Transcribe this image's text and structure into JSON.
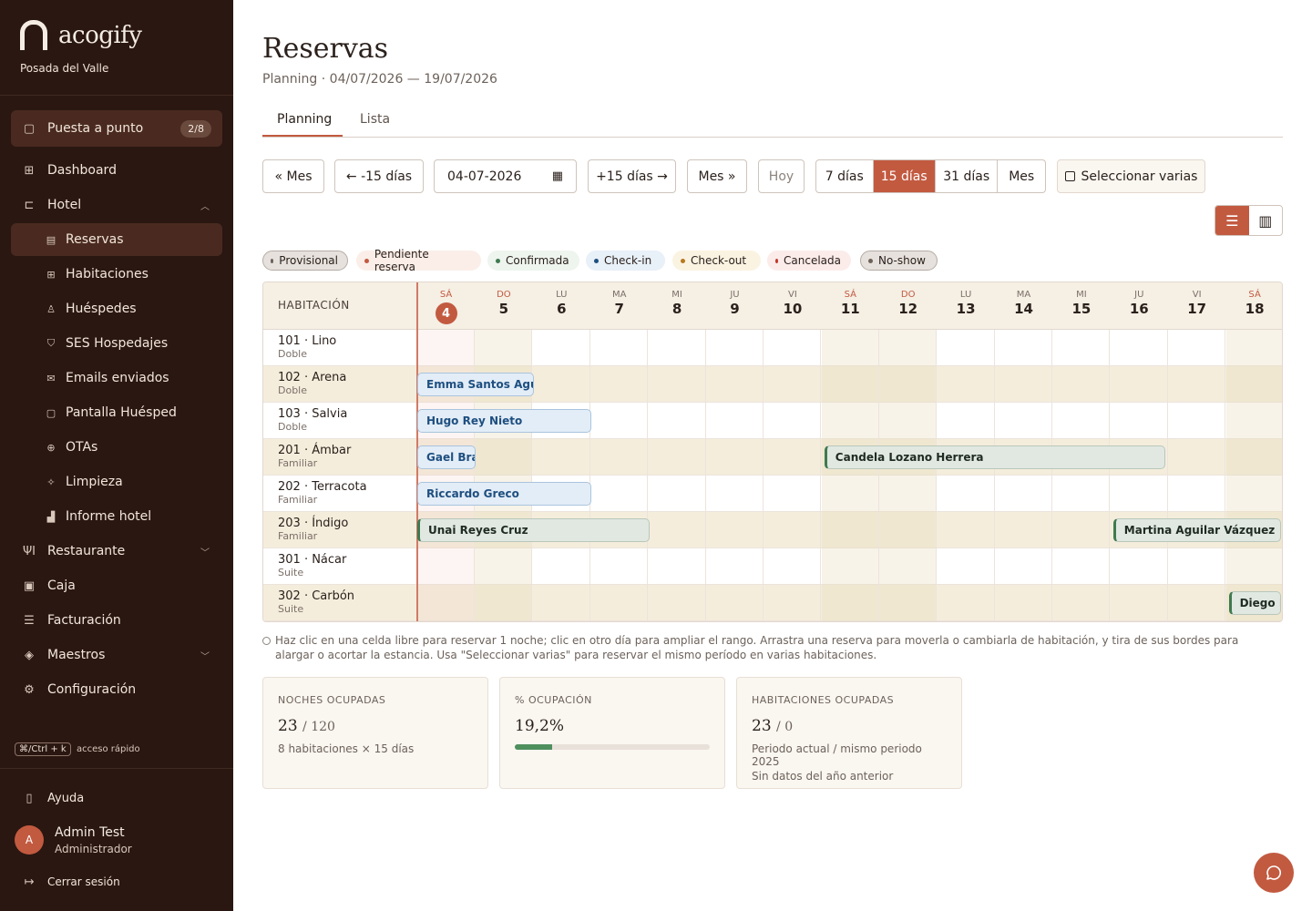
{
  "sidebar": {
    "brand": "acogify",
    "hotel": "Posada del Valle",
    "items": [
      {
        "label": "Puesta a punto",
        "badge": "2/8"
      },
      {
        "label": "Dashboard"
      },
      {
        "label": "Hotel"
      },
      {
        "label": "Reservas"
      },
      {
        "label": "Habitaciones"
      },
      {
        "label": "Huéspedes"
      },
      {
        "label": "SES Hospedajes"
      },
      {
        "label": "Emails enviados"
      },
      {
        "label": "Pantalla Huésped"
      },
      {
        "label": "OTAs"
      },
      {
        "label": "Limpieza"
      },
      {
        "label": "Informe hotel"
      },
      {
        "label": "Restaurante"
      },
      {
        "label": "Caja"
      },
      {
        "label": "Facturación"
      },
      {
        "label": "Maestros"
      },
      {
        "label": "Configuración"
      }
    ],
    "shortcut_key": "⌘/Ctrl + k",
    "shortcut_label": "acceso rápido",
    "help": "Ayuda",
    "user_initial": "A",
    "user_name": "Admin Test",
    "user_role": "Administrador",
    "logout": "Cerrar sesión"
  },
  "page": {
    "title": "Reservas",
    "subtitle": "Planning · 04/07/2026 — 19/07/2026"
  },
  "tabs": [
    "Planning",
    "Lista"
  ],
  "toolbar": {
    "prev_month": "« Mes",
    "prev_15": "← -15 días",
    "date": "04-07-2026",
    "next_15": "+15 días →",
    "next_month": "Mes »",
    "today": "Hoy",
    "ranges": [
      "7 días",
      "15 días",
      "31 días",
      "Mes"
    ],
    "multi": "Seleccionar varias"
  },
  "legend": [
    {
      "label": "Provisional",
      "color": "#6d625b",
      "bg": "#e6e1dc"
    },
    {
      "label": "Pendiente reserva",
      "color": "#c25a40",
      "bg": "#fbeee8"
    },
    {
      "label": "Confirmada",
      "color": "#3f7a4f",
      "bg": "#eef4ee"
    },
    {
      "label": "Check-in",
      "color": "#1e4f80",
      "bg": "#e8f0f8"
    },
    {
      "label": "Check-out",
      "color": "#b7791f",
      "bg": "#fbf3e2"
    },
    {
      "label": "Cancelada",
      "color": "#c0392b",
      "bg": "#fbecea"
    },
    {
      "label": "No-show",
      "color": "#6d625b",
      "bg": "#e6e1dc"
    }
  ],
  "planning": {
    "room_header": "HABITACIÓN",
    "days": [
      {
        "n": "SÁ",
        "d": "4"
      },
      {
        "n": "DO",
        "d": "5"
      },
      {
        "n": "LU",
        "d": "6"
      },
      {
        "n": "MA",
        "d": "7"
      },
      {
        "n": "MI",
        "d": "8"
      },
      {
        "n": "JU",
        "d": "9"
      },
      {
        "n": "VI",
        "d": "10"
      },
      {
        "n": "SÁ",
        "d": "11"
      },
      {
        "n": "DO",
        "d": "12"
      },
      {
        "n": "LU",
        "d": "13"
      },
      {
        "n": "MA",
        "d": "14"
      },
      {
        "n": "MI",
        "d": "15"
      },
      {
        "n": "JU",
        "d": "16"
      },
      {
        "n": "VI",
        "d": "17"
      },
      {
        "n": "SÁ",
        "d": "18"
      }
    ],
    "rooms": [
      {
        "name": "101 · Lino",
        "type": "Doble"
      },
      {
        "name": "102 · Arena",
        "type": "Doble"
      },
      {
        "name": "103 · Salvia",
        "type": "Doble"
      },
      {
        "name": "201 · Ámbar",
        "type": "Familiar"
      },
      {
        "name": "202 · Terracota",
        "type": "Familiar"
      },
      {
        "name": "203 · Índigo",
        "type": "Familiar"
      },
      {
        "name": "301 · Nácar",
        "type": "Suite"
      },
      {
        "name": "302 · Carbón",
        "type": "Suite"
      }
    ],
    "reservations": [
      {
        "guest": "Emma Santos Aguila",
        "room": 1,
        "start": 0,
        "nights": 2,
        "status": "Check-in"
      },
      {
        "guest": "Hugo Rey Nieto",
        "room": 2,
        "start": 0,
        "nights": 3,
        "status": "Check-in"
      },
      {
        "guest": "Gael Brav",
        "room": 3,
        "start": 0,
        "nights": 1,
        "status": "Check-in"
      },
      {
        "guest": "Candela Lozano Herrera",
        "room": 3,
        "start": 7,
        "nights": 6,
        "status": "Confirmada"
      },
      {
        "guest": "Riccardo Greco",
        "room": 4,
        "start": 0,
        "nights": 3,
        "status": "Check-in"
      },
      {
        "guest": "Unai Reyes Cruz",
        "room": 5,
        "start": 0,
        "nights": 4,
        "status": "Confirmada"
      },
      {
        "guest": "Martina Aguilar Vázquez",
        "room": 5,
        "start": 12,
        "nights": 3,
        "status": "Confirmada"
      },
      {
        "guest": "Diego Igl",
        "room": 7,
        "start": 14,
        "nights": 1,
        "status": "Confirmada"
      }
    ]
  },
  "hint": "Haz clic en una celda libre para reservar 1 noche; clic en otro día para ampliar el rango. Arrastra una reserva para moverla o cambiarla de habitación, y tira de sus bordes para alargar o acortar la estancia. Usa \"Seleccionar varias\" para reservar el mismo período en varias habitaciones.",
  "stats": [
    {
      "label": "NOCHES OCUPADAS",
      "value": "23",
      "suffix": "/ 120",
      "note": "8 habitaciones × 15 días"
    },
    {
      "label": "% OCUPACIÓN",
      "value": "19,2%",
      "progress": 0.192
    },
    {
      "label": "HABITACIONES OCUPADAS",
      "value": "23",
      "suffix": "/ 0",
      "note": "Periodo actual / mismo periodo 2025",
      "note2": "Sin datos del año anterior"
    }
  ]
}
